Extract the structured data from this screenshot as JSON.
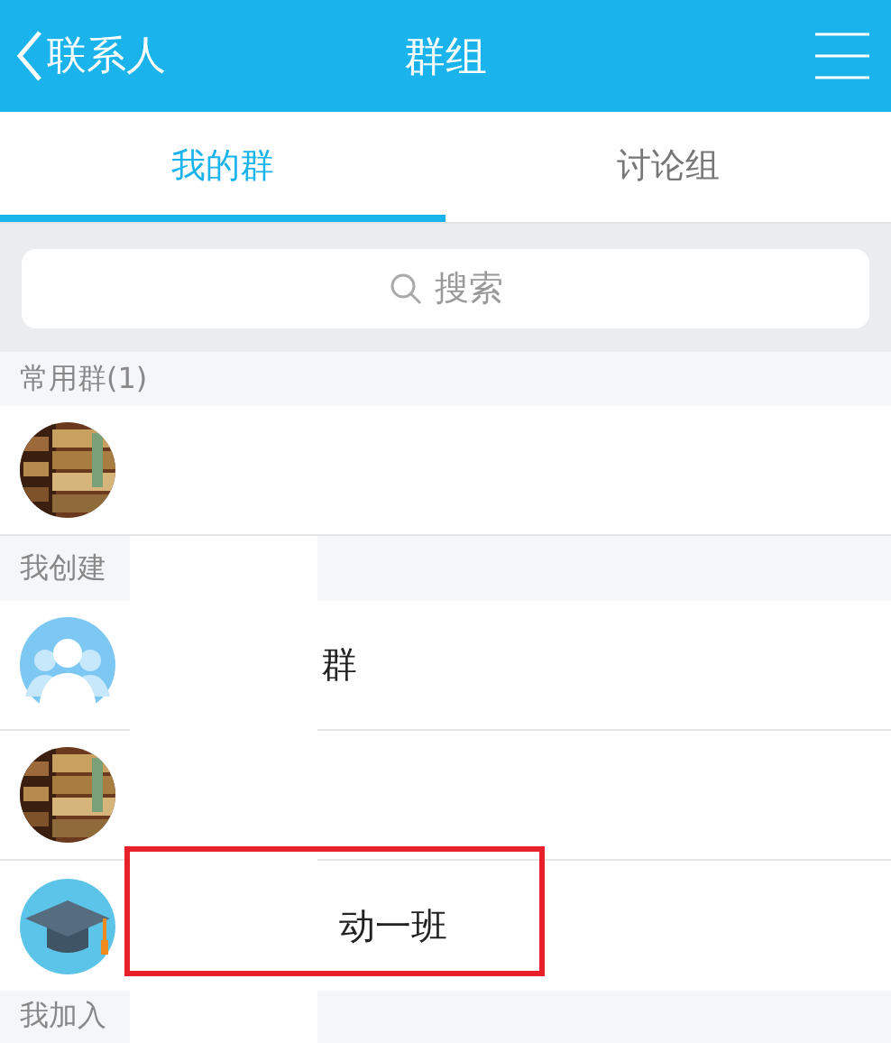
{
  "header": {
    "back_label": "联系人",
    "title": "群组"
  },
  "tabs": [
    {
      "label": "我的群",
      "selected": true
    },
    {
      "label": "讨论组",
      "selected": false
    }
  ],
  "search": {
    "placeholder": "搜索"
  },
  "sections": [
    {
      "title": "常用群(1)",
      "items": [
        {
          "kind": "picture"
        }
      ]
    },
    {
      "title": "我创建",
      "items": [
        {
          "kind": "people",
          "name": "群"
        },
        {
          "kind": "picture"
        },
        {
          "kind": "cap",
          "name": "动一班"
        }
      ]
    },
    {
      "title": "我加入"
    }
  ]
}
